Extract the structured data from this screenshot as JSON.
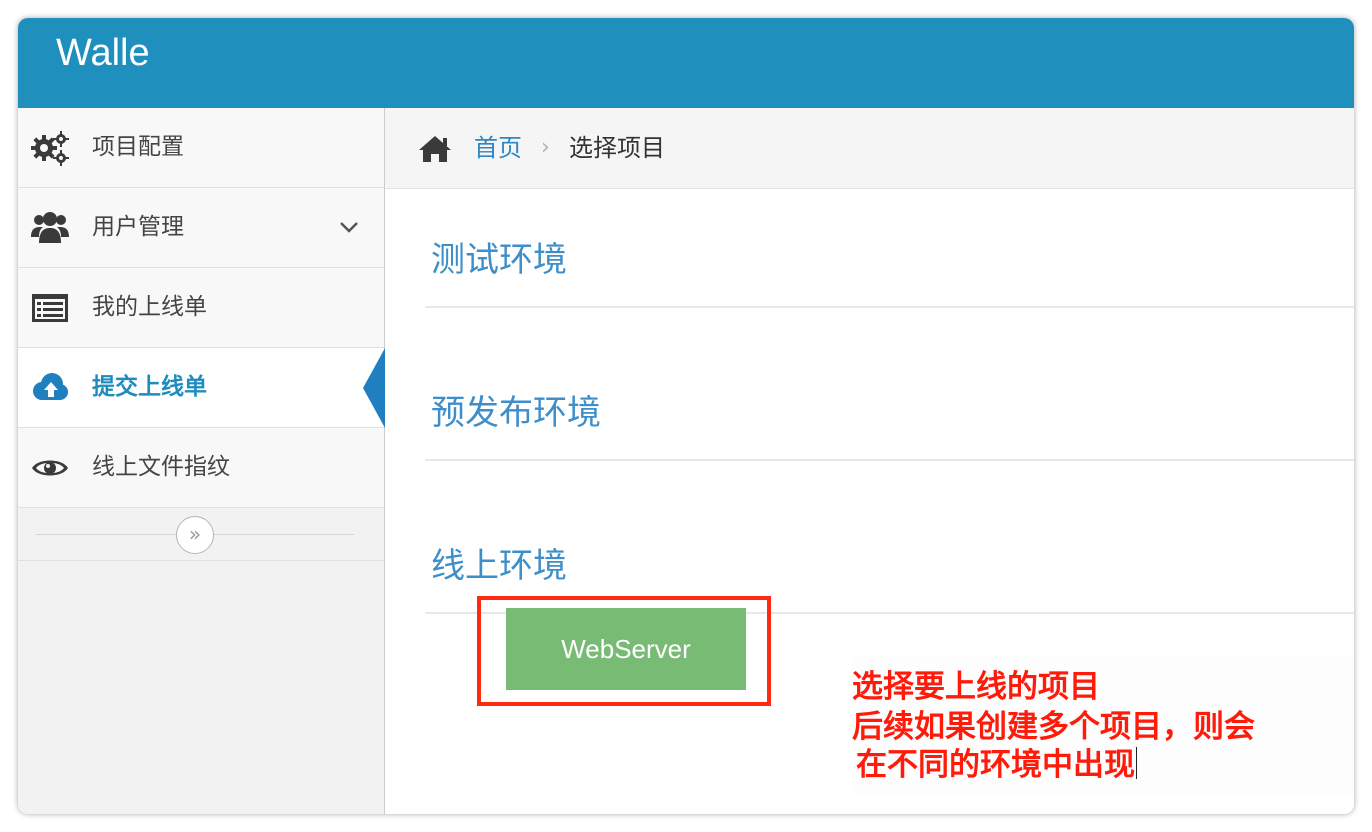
{
  "app": {
    "title": "Walle"
  },
  "sidebar": {
    "items": [
      {
        "label": "项目配置",
        "icon": "gears-icon",
        "active": false
      },
      {
        "label": "用户管理",
        "icon": "users-icon",
        "active": false,
        "expandable": true
      },
      {
        "label": "我的上线单",
        "icon": "list-icon",
        "active": false
      },
      {
        "label": "提交上线单",
        "icon": "cloud-upload-icon",
        "active": true
      },
      {
        "label": "线上文件指纹",
        "icon": "eye-icon",
        "active": false
      }
    ],
    "collapse_icon": "double-chevron-right-icon",
    "collapse_glyph": "»"
  },
  "breadcrumb": {
    "home_icon": "home-icon",
    "home_label": "首页",
    "separator": "›",
    "current": "选择项目"
  },
  "environments": [
    {
      "title": "测试环境",
      "projects": []
    },
    {
      "title": "预发布环境",
      "projects": []
    },
    {
      "title": "线上环境",
      "projects": [
        "WebServer"
      ]
    }
  ],
  "annotation": {
    "lines": [
      "选择要上线的项目",
      "后续如果创建多个项目，则会",
      "在不同的环境中出现"
    ]
  },
  "colors": {
    "navbar": "#1f90bd",
    "active_link": "#1f8cbe",
    "env_title": "#3d8ec9",
    "project_button": "#77bb74",
    "annotation_text": "#ff1a0a",
    "highlight_border": "#ff2a10"
  }
}
